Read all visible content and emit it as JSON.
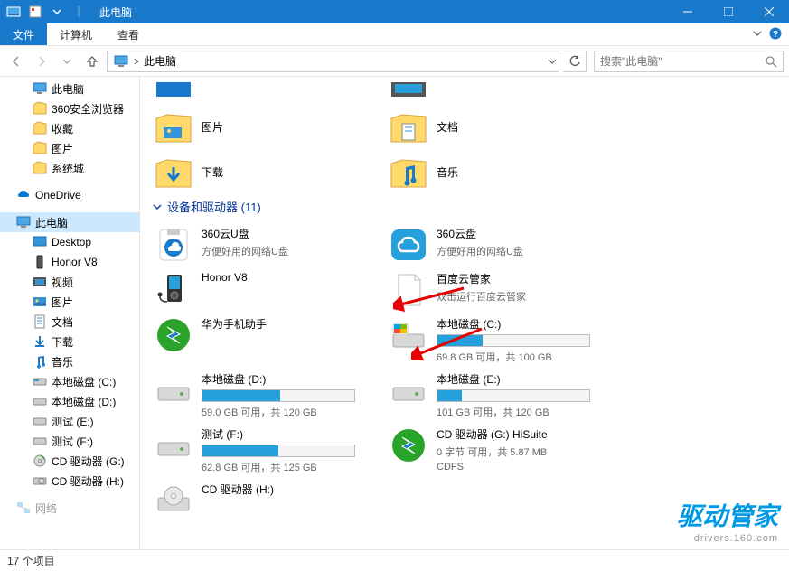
{
  "title": "此电脑",
  "ribbon": {
    "file": "文件",
    "computer": "计算机",
    "view": "查看"
  },
  "nav": {
    "crumb": "此电脑"
  },
  "search": {
    "placeholder": "搜索\"此电脑\""
  },
  "sidebar": {
    "thispc_top": "此电脑",
    "browser360": "360安全浏览器",
    "favorites": "收藏",
    "pictures": "图片",
    "systemcity": "系统城",
    "onedrive": "OneDrive",
    "thispc": "此电脑",
    "desktop": "Desktop",
    "honorv8": "Honor V8",
    "videos": "视频",
    "pictures2": "图片",
    "documents": "文档",
    "downloads": "下载",
    "music": "音乐",
    "diskc": "本地磁盘 (C:)",
    "diskd": "本地磁盘 (D:)",
    "teste": "测试 (E:)",
    "testf": "测试 (F:)",
    "cdg": "CD 驱动器 (G:)",
    "cdh": "CD 驱动器 (H:)",
    "network": "网络"
  },
  "content": {
    "section_devices": "设备和驱动器 (11)",
    "folders": {
      "pictures": "图片",
      "documents": "文档",
      "downloads": "下载",
      "music": "音乐"
    },
    "drives": {
      "udisk360": {
        "name": "360云U盘",
        "sub": "方便好用的网络U盘"
      },
      "cloud360": {
        "name": "360云盘",
        "sub": "方便好用的网络U盘"
      },
      "honorv8": {
        "name": "Honor V8"
      },
      "baidu": {
        "name": "百度云管家",
        "sub": "双击运行百度云管家"
      },
      "huawei": {
        "name": "华为手机助手"
      },
      "diskc": {
        "name": "本地磁盘 (C:)",
        "sub": "69.8 GB 可用，共 100 GB",
        "pct": 30
      },
      "diskd": {
        "name": "本地磁盘 (D:)",
        "sub": "59.0 GB 可用，共 120 GB",
        "pct": 51
      },
      "diske": {
        "name": "本地磁盘 (E:)",
        "sub": "101 GB 可用，共 120 GB",
        "pct": 16
      },
      "testf": {
        "name": "测试 (F:)",
        "sub": "62.8 GB 可用，共 125 GB",
        "pct": 50
      },
      "cdg": {
        "name": "CD 驱动器 (G:) HiSuite",
        "sub1": "0 字节 可用，共 5.87 MB",
        "sub2": "CDFS"
      },
      "cdh": {
        "name": "CD 驱动器 (H:)"
      }
    }
  },
  "statusbar": "17 个项目",
  "watermark": {
    "line1": "驱动管家",
    "line2": "drivers.160.com"
  }
}
